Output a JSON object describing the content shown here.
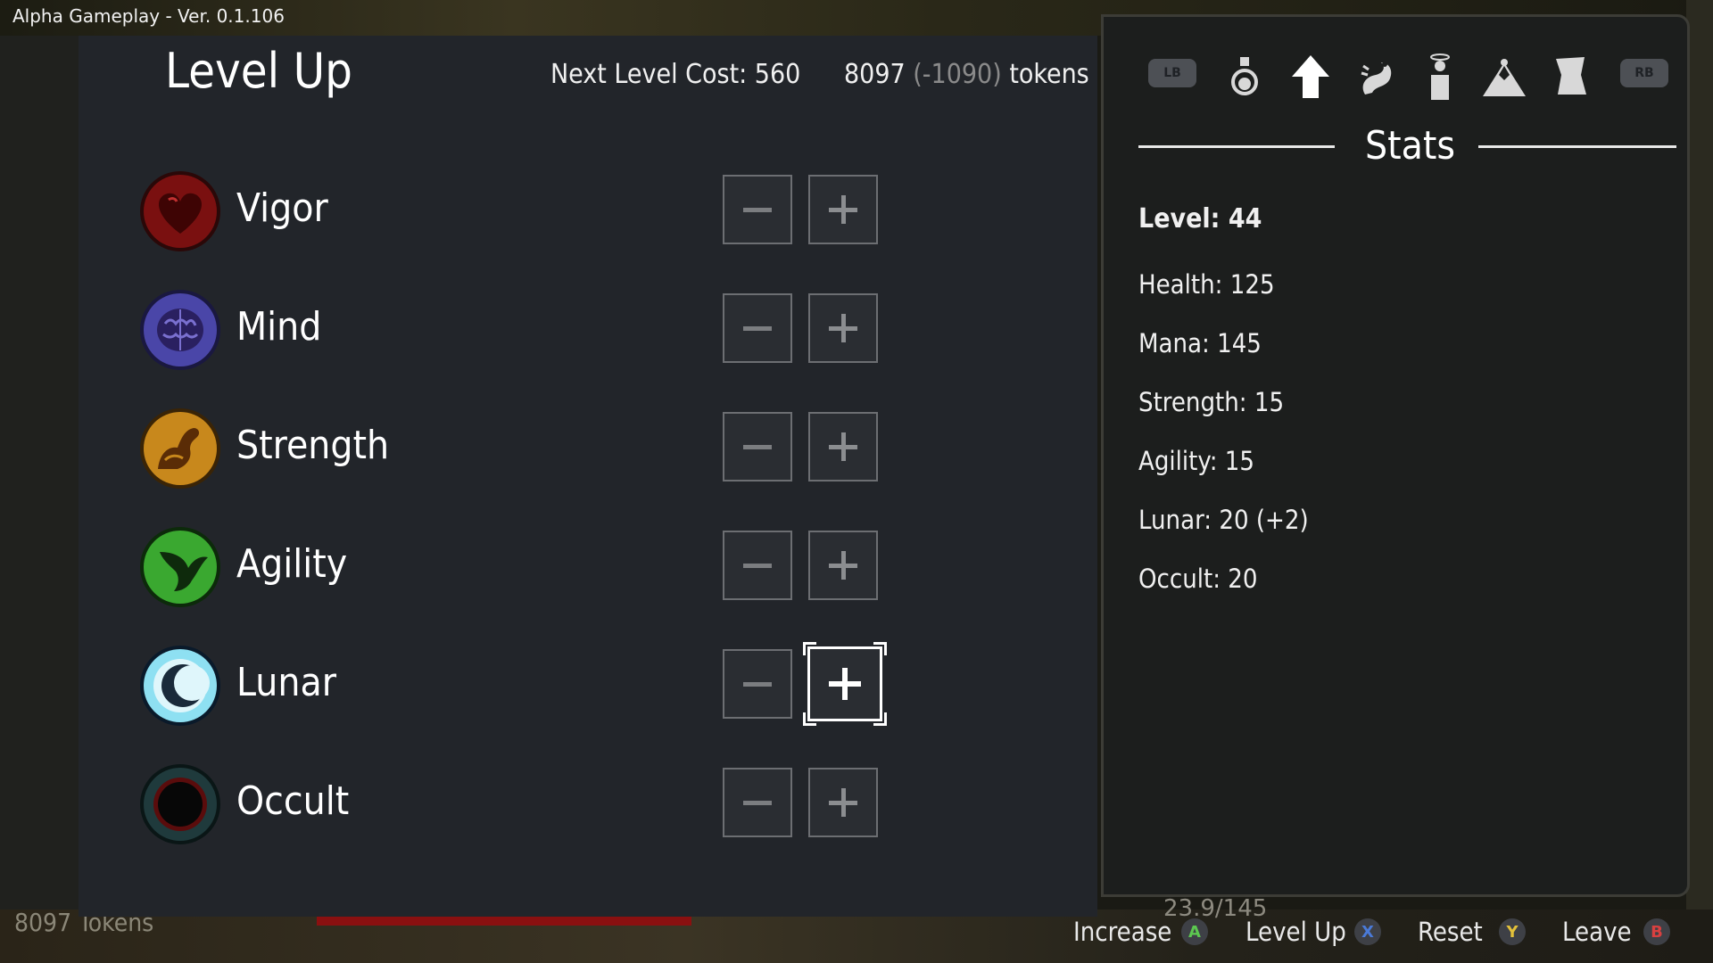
{
  "window": {
    "version": "Alpha Gameplay - Ver. 0.1.106"
  },
  "background": {
    "tokens_label": "8097 Tokens",
    "mana_readout": "23.9/145"
  },
  "level_up": {
    "title": "Level Up",
    "next_level_cost": "Next Level Cost: 560",
    "tokens": {
      "amount": "8097",
      "delta": "(-1090)",
      "unit": "tokens"
    },
    "attributes": [
      {
        "label": "Vigor",
        "icon": "heart-icon",
        "color": "#8b1515",
        "focused": false
      },
      {
        "label": "Mind",
        "icon": "brain-icon",
        "color": "#3b3482",
        "focused": false
      },
      {
        "label": "Strength",
        "icon": "flexed-arm-icon",
        "color": "#c88a1c",
        "focused": false
      },
      {
        "label": "Agility",
        "icon": "wing-icon",
        "color": "#2f9b2a",
        "focused": false
      },
      {
        "label": "Lunar",
        "icon": "crescent-moon-icon",
        "color": "#6fd0e8",
        "focused": true
      },
      {
        "label": "Occult",
        "icon": "dark-orb-icon",
        "color": "#5b1010",
        "focused": false
      }
    ],
    "minus_symbol": "−",
    "plus_symbol": "+"
  },
  "tabs": {
    "left_bumper": "LB",
    "right_bumper": "RB",
    "icons": [
      "potion-icon",
      "level-up-arrow-icon",
      "dragon-icon",
      "figure-icon",
      "camp-icon",
      "scroll-map-icon"
    ]
  },
  "stats": {
    "header": "Stats",
    "level": "Level: 44",
    "health": "Health: 125",
    "mana": "Mana: 145",
    "strength": "Strength: 15",
    "agility": "Agility: 15",
    "lunar": "Lunar: 20 (+2)",
    "occult": "Occult: 20"
  },
  "prompts": [
    {
      "label": "Increase",
      "button": "A",
      "color": "#5cc850"
    },
    {
      "label": "Level Up",
      "button": "X",
      "color": "#4a7ad8"
    },
    {
      "label": "Reset",
      "button": "Y",
      "color": "#e2c03a"
    },
    {
      "label": "Leave",
      "button": "B",
      "color": "#d84040"
    }
  ]
}
